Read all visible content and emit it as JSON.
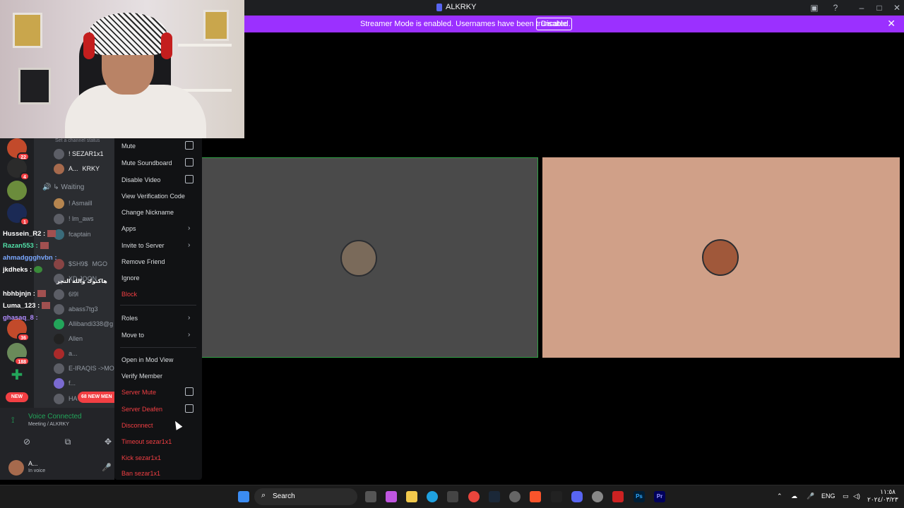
{
  "window": {
    "title": "ALKRKY"
  },
  "banner": {
    "message": "Streamer Mode is enabled. Usernames have been truncated.",
    "disable_label": "Disable"
  },
  "servers": [
    {
      "badge": "22"
    },
    {
      "badge": "4"
    },
    {
      "badge": ""
    },
    {
      "badge": "1"
    },
    {
      "badge": ""
    },
    {
      "badge": "36"
    },
    {
      "badge": "188"
    },
    {
      "badge": ""
    }
  ],
  "server_new_label": "NEW",
  "channel": {
    "status_placeholder": "Set a channel status",
    "waiting_label": "Waiting",
    "members_top": [
      "! SEZAR1x1",
      "A...",
      "KRKY"
    ],
    "members": [
      "! Asmaill",
      "! lm_aws",
      "fcaptain",
      "$SH9$",
      "MGO",
      "XD JOON",
      "6l9l",
      "abass7tg3",
      "Allibandi338@g",
      "Allen",
      "a...",
      "E-IRAQIS ->MO",
      "f...",
      "HA"
    ],
    "new_mentions_label": "68 NEW MEN"
  },
  "chat_overlay": [
    {
      "user": "Hussein_R2 :",
      "color": "#ffffff"
    },
    {
      "user": "Razan553 :",
      "color": "#52e0a8"
    },
    {
      "user": "ahmadggghvbn :",
      "color": "#7aa7ff"
    },
    {
      "user": "jkdheks :",
      "color": "#ffffff"
    },
    {
      "user": "هاكنوك والله التجر",
      "color": "#ffffff"
    },
    {
      "user": "hbhbjnjn :",
      "color": "#ffffff"
    },
    {
      "user": "Luma_123 :",
      "color": "#ffffff"
    },
    {
      "user": "ghasaq_8 :",
      "color": "#b18cff"
    }
  ],
  "voice": {
    "state": "Voice Connected",
    "channel": "Meeting / ALKRKY"
  },
  "user": {
    "name": "A...",
    "status": "In voice"
  },
  "context_menu": {
    "mute": "Mute",
    "mute_soundboard": "Mute Soundboard",
    "disable_video": "Disable Video",
    "view_verification": "View Verification Code",
    "change_nickname": "Change Nickname",
    "apps": "Apps",
    "invite": "Invite to Server",
    "remove_friend": "Remove Friend",
    "ignore": "Ignore",
    "block": "Block",
    "roles": "Roles",
    "move_to": "Move to",
    "open_mod_view": "Open in Mod View",
    "verify_member": "Verify Member",
    "server_mute": "Server Mute",
    "server_deafen": "Server Deafen",
    "disconnect": "Disconnect",
    "timeout": "Timeout sezar1x1",
    "kick": "Kick sezar1x1",
    "ban": "Ban sezar1x1"
  },
  "taskbar": {
    "search_label": "Search",
    "lang": "ENG",
    "time": "١١:٥٨",
    "date": "٢٠٢٤/٠٣/٢٣"
  },
  "colors": {
    "accent": "#5865f2",
    "banner": "#9b30ff",
    "danger": "#f23f43",
    "online": "#23a55a"
  }
}
